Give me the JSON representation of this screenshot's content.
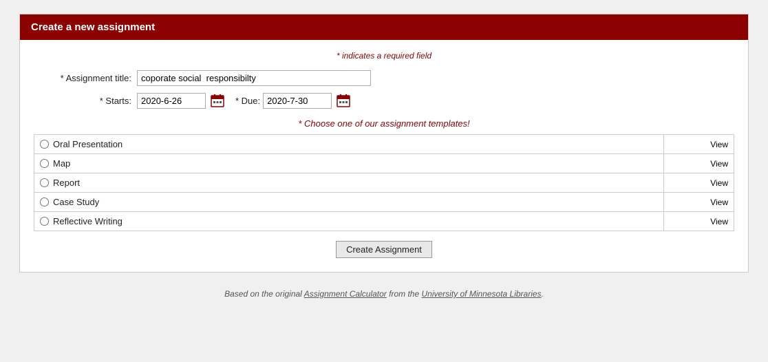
{
  "header": {
    "title": "Create a new assignment"
  },
  "form": {
    "required_note": "* indicates a required field",
    "assignment_title_label": "* Assignment title:",
    "assignment_title_value": "coporate social  responsibilty",
    "starts_label": "* Starts:",
    "starts_value": "2020-6-26",
    "due_label": "* Due:",
    "due_value": "2020-7-30",
    "template_note": "* Choose one of our assignment templates!",
    "templates": [
      {
        "id": "t1",
        "label": "Oral Presentation",
        "view_text": "View"
      },
      {
        "id": "t2",
        "label": "Map",
        "view_text": "View"
      },
      {
        "id": "t3",
        "label": "Report",
        "view_text": "View"
      },
      {
        "id": "t4",
        "label": "Case Study",
        "view_text": "View"
      },
      {
        "id": "t5",
        "label": "Reflective Writing",
        "view_text": "View"
      }
    ],
    "submit_label": "Create Assignment"
  },
  "footer": {
    "text_before": "Based on the original ",
    "link1_text": "Assignment Calculator",
    "text_middle": " from the ",
    "link2_text": "University of Minnesota Libraries",
    "text_after": "."
  }
}
